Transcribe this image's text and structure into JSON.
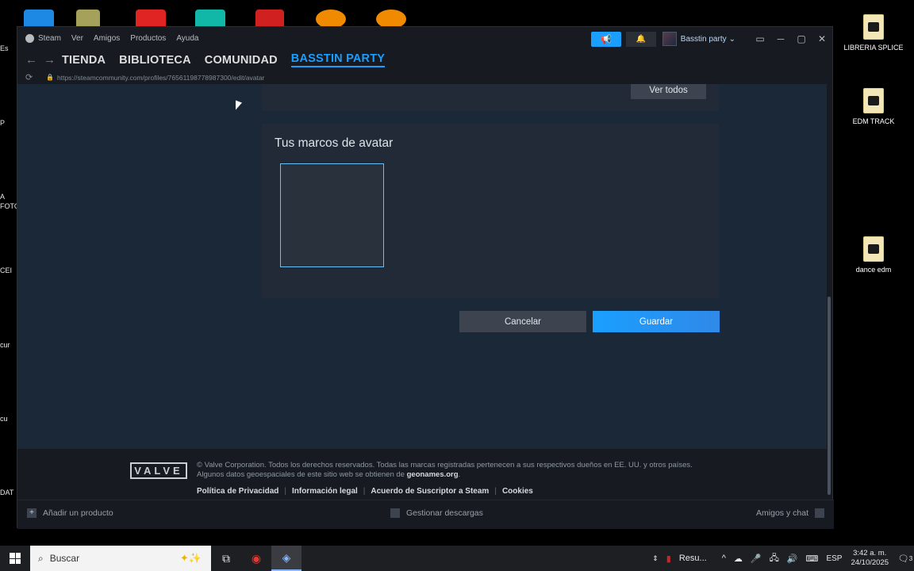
{
  "desktop": {
    "left_labels": [
      "Es",
      "P",
      "A",
      "FOTO",
      "CEI",
      "cur",
      "cu",
      "DAT"
    ],
    "folders": [
      {
        "label": "LIBRERIA SPLICE"
      },
      {
        "label": "EDM TRACK"
      },
      {
        "label": "dance edm"
      }
    ],
    "top_icon_colors": [
      "#1e88e5",
      "#a5a05a",
      "#e02424",
      "#11b8a8",
      "#d02020",
      "#f08a00",
      "#f08a00"
    ]
  },
  "steam": {
    "menu": [
      "Steam",
      "Ver",
      "Amigos",
      "Productos",
      "Ayuda"
    ],
    "user": {
      "name": "Basstin party",
      "chevron": "⌄"
    },
    "window_controls": {
      "minimize": "─",
      "maximize": "▢",
      "close": "✕"
    },
    "nav": {
      "back": "←",
      "forward": "→",
      "items": [
        "TIENDA",
        "BIBLIOTECA",
        "COMUNIDAD",
        "BASSTIN PARTY"
      ]
    },
    "url": "https://steamcommunity.com/profiles/76561198778987300/edit/avatar",
    "content": {
      "ver_todos": "Ver todos",
      "frames_title": "Tus marcos de avatar",
      "cancel": "Cancelar",
      "save": "Guardar"
    },
    "footer": {
      "valve_logo": "VALVE",
      "legal_line1": "© Valve Corporation. Todos los derechos reservados. Todas las marcas registradas pertenecen a sus respectivos dueños en EE. UU. y otros países.",
      "legal_line2_prefix": "Algunos datos geoespaciales de este sitio web se obtienen de ",
      "legal_line2_link": "geonames.org",
      "links": [
        "Política de Privacidad",
        "Información legal",
        "Acuerdo de Suscriptor a Steam",
        "Cookies"
      ]
    },
    "bottombar": {
      "add_product": "Añadir un producto",
      "downloads": "Gestionar descargas",
      "friends": "Amigos y chat"
    }
  },
  "taskbar": {
    "search_placeholder": "Buscar",
    "pinned_app": "Resu...",
    "lang": "ESP",
    "time": "3:42 a. m.",
    "date": "24/10/2025",
    "notifications": "3"
  }
}
